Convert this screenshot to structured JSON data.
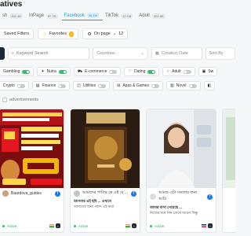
{
  "header": {
    "title": "atives"
  },
  "tabs": [
    {
      "label": "sh",
      "count": "401.4K"
    },
    {
      "label": "InPage",
      "count": "97.7K"
    },
    {
      "label": "Facebook",
      "count": "38.1M",
      "active": true
    },
    {
      "label": "TikTok",
      "count": "12.1M"
    },
    {
      "label": "Adult",
      "count": "424.8K"
    }
  ],
  "toolbar": {
    "saved_filters": "Saved Filters",
    "favorites": "Favorites",
    "favorites_badge": "4",
    "on_page": "On page",
    "on_page_value": "12"
  },
  "filters": {
    "search_placeholder": "Keyword Search",
    "countries": "Countries",
    "creation_date": "Creation Date",
    "sort_by": "Sort By"
  },
  "categories_row1": [
    {
      "label": "Gambling",
      "on": true
    },
    {
      "label": "Nutra",
      "on": true
    },
    {
      "label": "E-commerce",
      "on": false
    },
    {
      "label": "Dating",
      "on": true
    },
    {
      "label": "Adult",
      "on": false
    },
    {
      "label": "Sw",
      "on": false
    }
  ],
  "categories_row2": [
    {
      "label": "Crypto",
      "on": false
    },
    {
      "label": "Finance",
      "on": false
    },
    {
      "label": "Utilities",
      "on": false
    },
    {
      "label": "Apps & Games",
      "on": false
    },
    {
      "label": "Novel",
      "on": false
    },
    {
      "label": "",
      "on": false
    }
  ],
  "section": {
    "label": "advertisements"
  },
  "cards": [
    {
      "name": "Baardova_guides",
      "line1": "",
      "line2": "",
      "status": "Active",
      "info": "i"
    },
    {
      "name": "আমাদের পাতির কে এই যে ...",
      "line1": "আপনার এই ছবি ... এখানে",
      "line2": "আমাদের জন্য পছন্দ এই কথা",
      "status": "Active",
      "info": "i"
    },
    {
      "name": "আমার এটা সকলের জন্য আমি",
      "line1": "আমার বাসা পেয়েছে ...",
      "line2": "নিজের মনে নিন জেনে যাবেন কিন্তু",
      "status": "Active",
      "info": "i"
    },
    {
      "name": "",
      "line1": "",
      "line2": "",
      "status": "",
      "info": ""
    }
  ],
  "colors": {
    "accent": "#1e9ce0",
    "active": "#33c06a",
    "dark": "#1b2a3a"
  }
}
